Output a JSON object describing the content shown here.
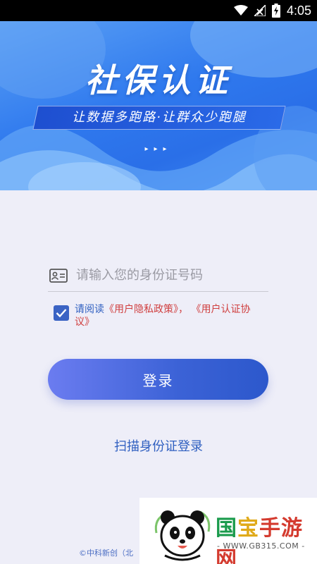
{
  "status_bar": {
    "time": "4:05",
    "icons": [
      "wifi-icon",
      "signal-icon",
      "battery-charging-icon"
    ]
  },
  "banner": {
    "title": "社保认证",
    "slogan": "让数据多跑路·让群众少跑腿",
    "arrows": "▸▸▸"
  },
  "login_form": {
    "id_input": {
      "placeholder": "请输入您的身份证号码",
      "value": ""
    },
    "agreement": {
      "checked": true,
      "prefix": "请阅读",
      "privacy_link": "《用户隐私政策》",
      "separator": "，",
      "auth_link": "《用户认证协议》"
    },
    "login_button": "登录",
    "scan_login": "扫描身份证登录"
  },
  "footer": {
    "copyright": "©中科新创（北"
  },
  "watermark": {
    "name_parts": [
      "国",
      "宝",
      "手游网"
    ],
    "url": "- WWW.GB315.COM -"
  },
  "colors": {
    "accent_blue": "#2f5fc0",
    "link_red": "#d04040",
    "background": "#eeeef8",
    "button_gradient_start": "#6b7cf0",
    "button_gradient_end": "#2c58cc"
  }
}
